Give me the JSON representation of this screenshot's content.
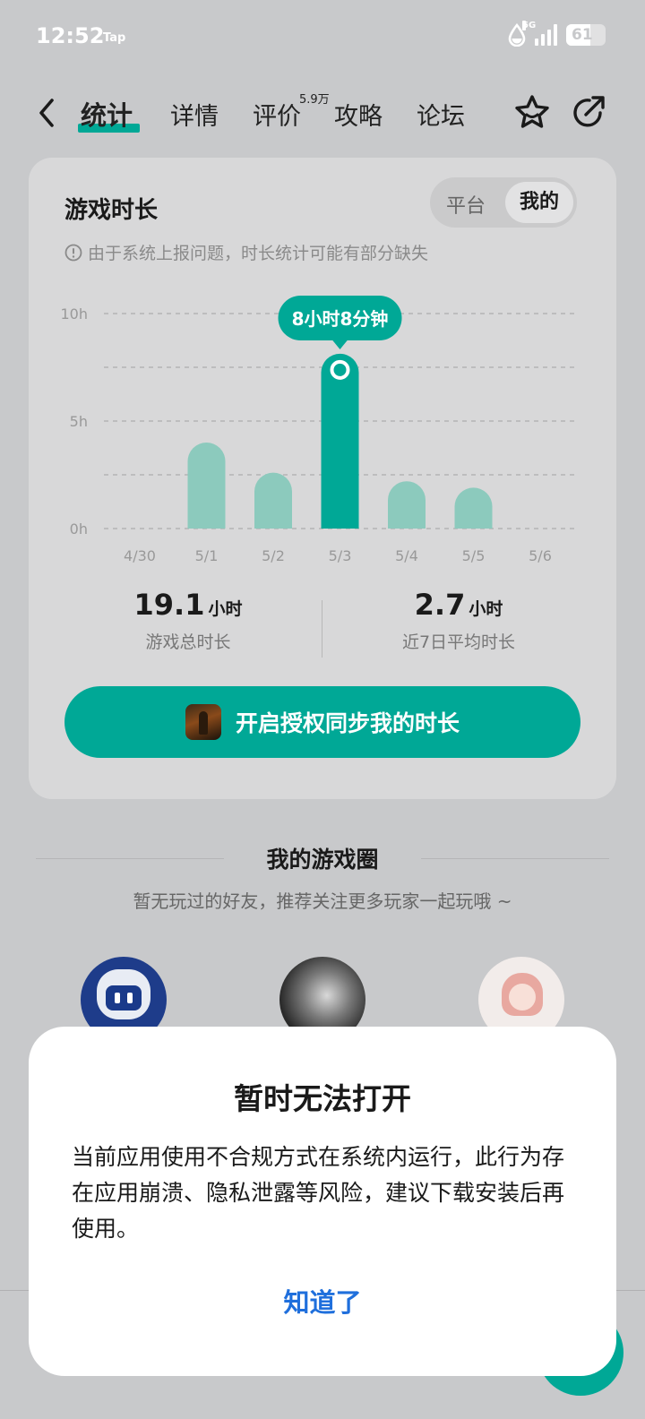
{
  "status_bar": {
    "time": "12:52",
    "tap_label": "Tap",
    "network": "5G",
    "battery": "61"
  },
  "nav": {
    "tabs": [
      {
        "label": "统计",
        "active": true
      },
      {
        "label": "详情"
      },
      {
        "label": "评价",
        "badge": "5.9万"
      },
      {
        "label": "攻略"
      },
      {
        "label": "论坛"
      }
    ],
    "icons": [
      "back-icon",
      "star-icon",
      "share-icon"
    ]
  },
  "card": {
    "title": "游戏时长",
    "segment": {
      "options": [
        "平台",
        "我的"
      ],
      "selected": "我的"
    },
    "notice": "由于系统上报问题，时长统计可能有部分缺失"
  },
  "chart_data": {
    "type": "bar",
    "categories": [
      "4/30",
      "5/1",
      "5/2",
      "5/3",
      "5/4",
      "5/5",
      "5/6"
    ],
    "values": [
      0,
      4.0,
      2.6,
      8.13,
      2.2,
      1.9,
      0
    ],
    "highlight_index": 3,
    "tooltip": "8小时8分钟",
    "yticks": [
      "0h",
      "5h",
      "10h"
    ],
    "ylim": [
      0,
      10
    ],
    "grid": true,
    "colors": {
      "bar": "#8ccabd",
      "highlight": "#00a896"
    }
  },
  "stats": {
    "total": {
      "value": "19.1",
      "unit": "小时",
      "label": "游戏总时长"
    },
    "average": {
      "value": "2.7",
      "unit": "小时",
      "label": "近7日平均时长"
    }
  },
  "sync_button": {
    "label": "开启授权同步我的时长"
  },
  "game_circle": {
    "title": "我的游戏圈",
    "subtitle": "暂无玩过的好友，推荐关注更多玩家一起玩哦 ~"
  },
  "dialog": {
    "title": "暂时无法打开",
    "body": "当前应用使用不合规方式在系统内运行，此行为存在应用崩溃、隐私泄露等风险，建议下载安装后再使用。",
    "confirm": "知道了"
  }
}
